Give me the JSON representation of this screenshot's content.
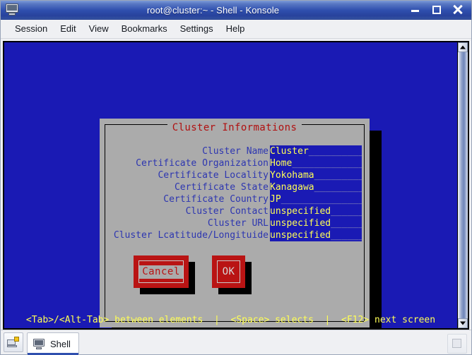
{
  "window": {
    "title": "root@cluster:~ - Shell - Konsole",
    "icon": "terminal-monitor-icon",
    "controls": {
      "minimize": "minimize-icon",
      "maximize": "maximize-icon",
      "close": "close-icon"
    }
  },
  "menubar": {
    "items": [
      {
        "label": "Session"
      },
      {
        "label": "Edit"
      },
      {
        "label": "View"
      },
      {
        "label": "Bookmarks"
      },
      {
        "label": "Settings"
      },
      {
        "label": "Help"
      }
    ]
  },
  "terminal": {
    "background_color": "#1a1ab4",
    "status_line": "<Tab>/<Alt-Tab> between elements  |  <Space> selects  |  <F12> next screen"
  },
  "dialog": {
    "title": "Cluster Informations",
    "title_color": "#b01010",
    "background_color": "#ababab",
    "label_color": "#2d36b0",
    "field_bg_color": "#1a1ab4",
    "field_text_color": "#ffff55",
    "fields": [
      {
        "label": "Cluster Name",
        "value": "Cluster",
        "fill": "__________"
      },
      {
        "label": "Certificate Organization",
        "value": "Home",
        "fill": "_____________"
      },
      {
        "label": "Certificate Locality",
        "value": "Yokohama",
        "fill": "_________"
      },
      {
        "label": "Certificate State",
        "value": "Kanagawa",
        "fill": "_________"
      },
      {
        "label": "Certificate Country",
        "value": "JP",
        "fill": "_______________"
      },
      {
        "label": "Cluster Contact",
        "value": "unspecified",
        "fill": "______"
      },
      {
        "label": "Cluster URL",
        "value": "unspecified",
        "fill": "______"
      },
      {
        "label": "Cluster Lcatitude/Longituide",
        "value": "unspecified",
        "fill": "______"
      }
    ],
    "buttons": [
      {
        "name": "cancel",
        "label": "Cancel",
        "focused": true
      },
      {
        "name": "ok",
        "label": "OK",
        "focused": false
      }
    ]
  },
  "tabbar": {
    "new_session_button": "new-session-icon",
    "tabs": [
      {
        "label": "Shell",
        "active": true
      }
    ],
    "right_button": "session-action-icon"
  }
}
